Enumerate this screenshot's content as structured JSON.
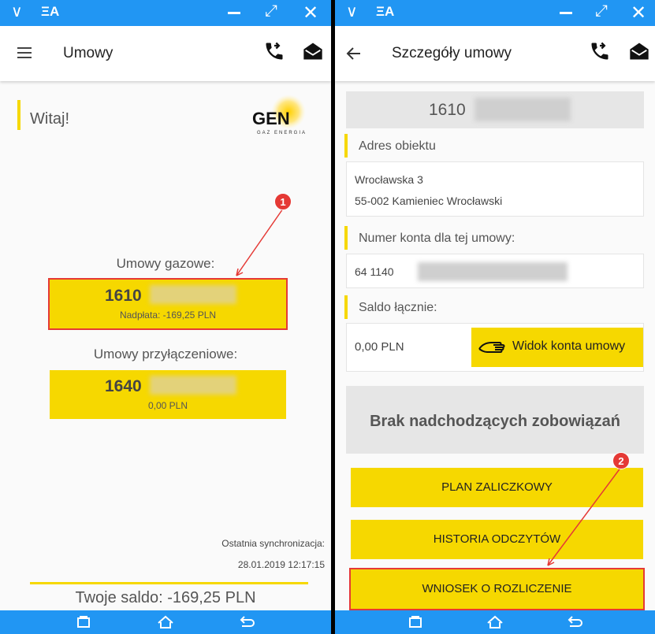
{
  "colors": {
    "accent_blue": "#2196f3",
    "brand_yellow": "#f6d800",
    "annotation_red": "#e53935"
  },
  "status_bar": {
    "brand_label": "ΞA"
  },
  "left": {
    "title": "Umowy",
    "greeting": "Witaj!",
    "logo_text": "GEN",
    "logo_sub": "GAZ ENERGIA",
    "gas_section_label": "Umowy gazowe:",
    "gas_contract": {
      "number": "1610",
      "subtitle": "Nadpłata: -169,25 PLN"
    },
    "connection_section_label": "Umowy przyłączeniowe:",
    "connection_contract": {
      "number": "1640",
      "subtitle": "0,00 PLN"
    },
    "sync_label": "Ostatnia synchronizacja:",
    "sync_time": "28.01.2019 12:17:15",
    "balance": "Twoje saldo: -169,25 PLN"
  },
  "right": {
    "title": "Szczegóły umowy",
    "contract_number": "1610",
    "address_label": "Adres obiektu",
    "address_line1": "Wrocławska 3",
    "address_line2": "55-002 Kamieniec Wrocławski",
    "account_label": "Numer konta dla tej umowy:",
    "account_number": "64 1140",
    "balance_label": "Saldo łącznie:",
    "balance_value": "0,00 PLN",
    "account_view_button": "Widok konta umowy",
    "no_due": "Brak nadchodzących zobowiązań",
    "buttons": {
      "plan": "PLAN ZALICZKOWY",
      "history": "HISTORIA ODCZYTÓW",
      "request": "WNIOSEK O ROZLICZENIE"
    }
  },
  "annotations": [
    "1",
    "2"
  ]
}
